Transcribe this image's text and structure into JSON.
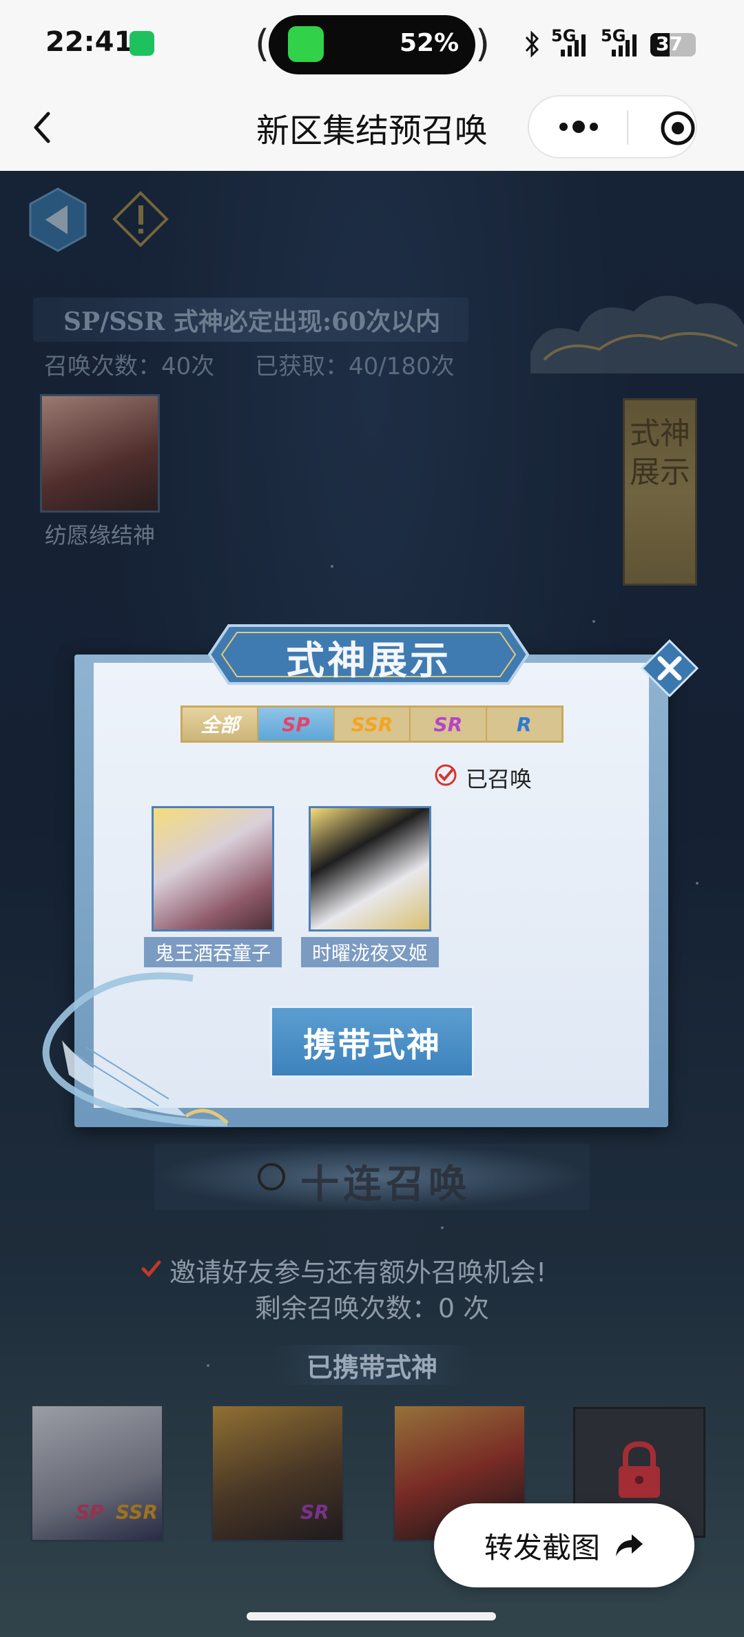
{
  "status_bar": {
    "time": "22:41",
    "battery_percent": "52%",
    "network_1": "5G",
    "network_2": "5G",
    "battery_level": "37"
  },
  "nav": {
    "title": "新区集结预召唤"
  },
  "event": {
    "guarantee_text": "SP/SSR 式神必定出现:60次以内",
    "summon_count": "召唤次数：40次",
    "obtained": "已获取：40/180次",
    "featured_name": "纺愿缘结神",
    "side_plaque": "式神展示"
  },
  "modal": {
    "title": "式神展示",
    "tabs": [
      {
        "label": "全部"
      },
      {
        "label": "SP"
      },
      {
        "label": "SSR"
      },
      {
        "label": "SR"
      },
      {
        "label": "R"
      }
    ],
    "summoned_label": "已召唤",
    "cards": [
      {
        "name": "鬼王酒吞童子"
      },
      {
        "name": "时曜泷夜叉姬"
      }
    ],
    "carry_button": "携带式神"
  },
  "summon": {
    "ten_pull_label": "十连召唤",
    "invite_text": "邀请好友参与还有额外召唤机会!",
    "remaining_text": "剩余召唤次数：0 次"
  },
  "carried": {
    "title": "已携带式神",
    "slot1_badges": [
      "SP",
      "SSR"
    ],
    "slot2_badge": "SR"
  },
  "share": {
    "label": "转发截图"
  },
  "colors": {
    "wechat_green": "#1dc25f",
    "accent_blue": "#4a8fc7",
    "gold": "#c9a85e"
  }
}
